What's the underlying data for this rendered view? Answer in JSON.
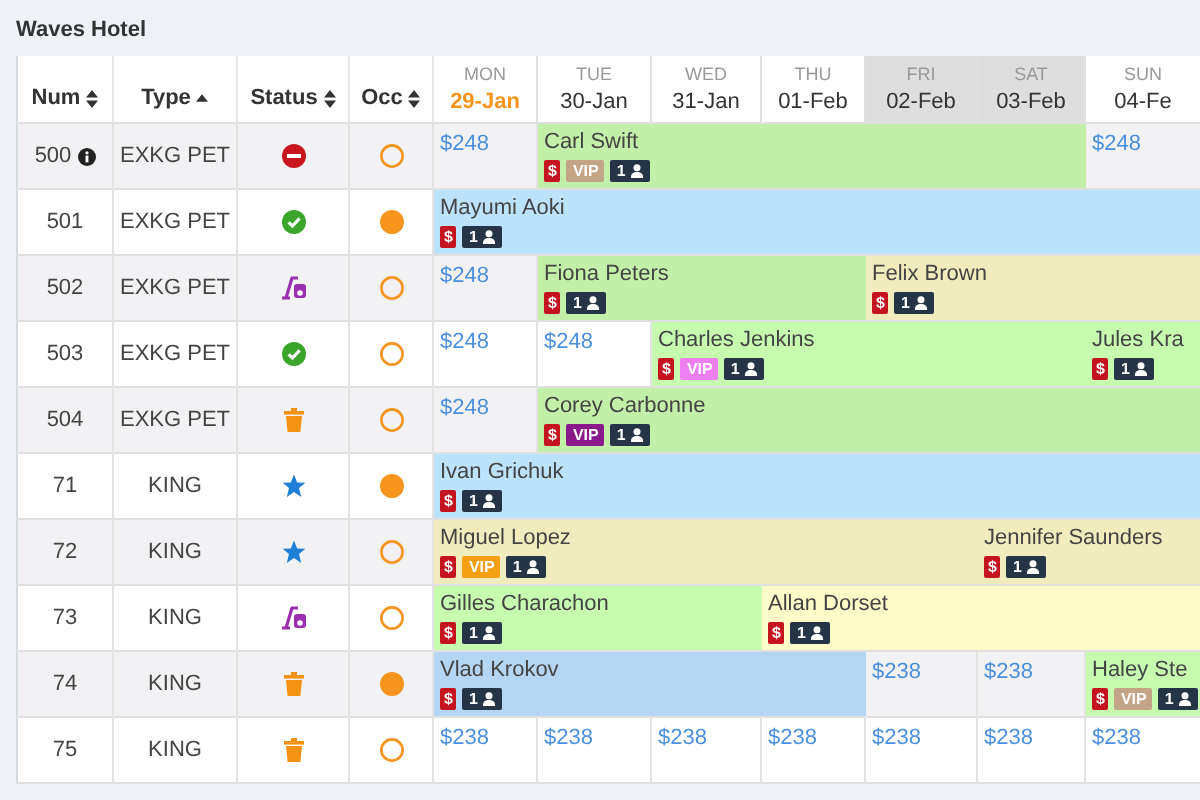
{
  "title": "Waves Hotel",
  "columns": [
    {
      "label": "Num",
      "sort": {
        "kind": "both"
      }
    },
    {
      "label": "Type",
      "sort": {
        "kind": "asc"
      }
    },
    {
      "label": "Status",
      "sort": {
        "kind": "both"
      }
    },
    {
      "label": "Occ",
      "sort": {
        "kind": "both"
      }
    }
  ],
  "days": [
    {
      "dow": "MON",
      "date": "29-Jan",
      "today": true,
      "weekend": false
    },
    {
      "dow": "TUE",
      "date": "30-Jan",
      "today": false,
      "weekend": false
    },
    {
      "dow": "WED",
      "date": "31-Jan",
      "today": false,
      "weekend": false
    },
    {
      "dow": "THU",
      "date": "01-Feb",
      "today": false,
      "weekend": false
    },
    {
      "dow": "FRI",
      "date": "02-Feb",
      "today": false,
      "weekend": true
    },
    {
      "dow": "SAT",
      "date": "03-Feb",
      "today": false,
      "weekend": true
    },
    {
      "dow": "SUN",
      "date": "04-Fe",
      "today": false,
      "weekend": false
    }
  ],
  "rooms": [
    {
      "num": "500",
      "info": true,
      "type": "EXKG PET",
      "status": {
        "kind": "blocked"
      },
      "occupied": false,
      "shaded": true,
      "cells": [
        {
          "kind": "price",
          "price": "$248"
        },
        {
          "kind": "booking",
          "guest": "Carl Swift",
          "color": "#c3f0a8",
          "paid": "$",
          "vip": {
            "text": "VIP",
            "color": "#c4a487"
          },
          "guests": "1"
        },
        {
          "kind": "stay"
        },
        {
          "kind": "stay"
        },
        {
          "kind": "stay"
        },
        {
          "kind": "stay"
        },
        {
          "kind": "price",
          "price": "$248"
        }
      ]
    },
    {
      "num": "501",
      "info": false,
      "type": "EXKG PET",
      "status": {
        "kind": "clean"
      },
      "occupied": true,
      "shaded": false,
      "cells": [
        {
          "kind": "booking",
          "guest": "Mayumi Aoki",
          "color": "#bde2fb",
          "paid": "$",
          "guests": "1"
        },
        {
          "kind": "stay"
        },
        {
          "kind": "stay"
        },
        {
          "kind": "stay"
        },
        {
          "kind": "stay"
        },
        {
          "kind": "stay"
        },
        {
          "kind": "stay"
        }
      ]
    },
    {
      "num": "502",
      "info": false,
      "type": "EXKG PET",
      "status": {
        "kind": "cleaning"
      },
      "occupied": false,
      "shaded": true,
      "cells": [
        {
          "kind": "price",
          "price": "$248"
        },
        {
          "kind": "booking",
          "guest": "Fiona Peters",
          "color": "#c3f0a8",
          "paid": "$",
          "guests": "1"
        },
        {
          "kind": "stay"
        },
        {
          "kind": "stay"
        },
        {
          "kind": "booking",
          "guest": "Felix Brown",
          "color": "#f1ecbe",
          "paid": "$",
          "guests": "1"
        },
        {
          "kind": "stay"
        },
        {
          "kind": "stay"
        }
      ]
    },
    {
      "num": "503",
      "info": false,
      "type": "EXKG PET",
      "status": {
        "kind": "clean"
      },
      "occupied": false,
      "shaded": false,
      "cells": [
        {
          "kind": "price",
          "price": "$248"
        },
        {
          "kind": "price",
          "price": "$248"
        },
        {
          "kind": "booking",
          "guest": "Charles Jenkins",
          "color": "#c6fbb0",
          "paid": "$",
          "vip": {
            "text": "VIP",
            "color": "#ee7ff0"
          },
          "guests": "1"
        },
        {
          "kind": "stay"
        },
        {
          "kind": "stay"
        },
        {
          "kind": "stay"
        },
        {
          "kind": "booking",
          "guest": "Jules Kra",
          "color": "#c6fbb0",
          "paid": "$",
          "guests": "1"
        }
      ]
    },
    {
      "num": "504",
      "info": false,
      "type": "EXKG PET",
      "status": {
        "kind": "dirty"
      },
      "occupied": false,
      "shaded": true,
      "cells": [
        {
          "kind": "price",
          "price": "$248"
        },
        {
          "kind": "booking",
          "guest": "Corey Carbonne",
          "color": "#c3f0a8",
          "paid": "$",
          "vip": {
            "text": "VIP",
            "color": "#8a1a8c"
          },
          "guests": "1"
        },
        {
          "kind": "stay"
        },
        {
          "kind": "stay"
        },
        {
          "kind": "stay"
        },
        {
          "kind": "stay"
        },
        {
          "kind": "stay"
        }
      ]
    },
    {
      "num": "71",
      "info": false,
      "type": "KING",
      "status": {
        "kind": "starred"
      },
      "occupied": true,
      "shaded": false,
      "cells": [
        {
          "kind": "booking",
          "guest": "Ivan Grichuk",
          "color": "#bde2fb",
          "paid": "$",
          "guests": "1"
        },
        {
          "kind": "stay"
        },
        {
          "kind": "stay"
        },
        {
          "kind": "stay"
        },
        {
          "kind": "stay"
        },
        {
          "kind": "stay"
        },
        {
          "kind": "stay"
        }
      ]
    },
    {
      "num": "72",
      "info": false,
      "type": "KING",
      "status": {
        "kind": "starred"
      },
      "occupied": false,
      "shaded": true,
      "cells": [
        {
          "kind": "booking",
          "guest": "Miguel Lopez",
          "color": "#f1ecbe",
          "paid": "$",
          "vip": {
            "text": "VIP",
            "color": "#f5a012"
          },
          "guests": "1"
        },
        {
          "kind": "stay"
        },
        {
          "kind": "stay"
        },
        {
          "kind": "stay"
        },
        {
          "kind": "stay"
        },
        {
          "kind": "booking",
          "guest": "Jennifer Saunders",
          "color": "#f1ecbe",
          "paid": "$",
          "guests": "1"
        },
        {
          "kind": "stay"
        }
      ]
    },
    {
      "num": "73",
      "info": false,
      "type": "KING",
      "status": {
        "kind": "cleaning"
      },
      "occupied": false,
      "shaded": false,
      "cells": [
        {
          "kind": "booking",
          "guest": "Gilles Charachon",
          "color": "#c6fbb0",
          "paid": "$",
          "guests": "1"
        },
        {
          "kind": "stay"
        },
        {
          "kind": "stay"
        },
        {
          "kind": "booking",
          "guest": "Allan Dorset",
          "color": "#fdfbc8",
          "paid": "$",
          "guests": "1"
        },
        {
          "kind": "stay"
        },
        {
          "kind": "stay"
        },
        {
          "kind": "stay"
        }
      ]
    },
    {
      "num": "74",
      "info": false,
      "type": "KING",
      "status": {
        "kind": "dirty"
      },
      "occupied": true,
      "shaded": true,
      "cells": [
        {
          "kind": "booking",
          "guest": "Vlad Krokov",
          "color": "#b5d6f2",
          "paid": "$",
          "guests": "1"
        },
        {
          "kind": "stay"
        },
        {
          "kind": "stay"
        },
        {
          "kind": "stay"
        },
        {
          "kind": "price",
          "price": "$238"
        },
        {
          "kind": "price",
          "price": "$238"
        },
        {
          "kind": "booking",
          "guest": "Haley Ste",
          "color": "#c6fbb0",
          "paid": "$",
          "vip": {
            "text": "VIP",
            "color": "#c4a487"
          },
          "guests": "1"
        }
      ]
    },
    {
      "num": "75",
      "info": false,
      "type": "KING",
      "status": {
        "kind": "dirty"
      },
      "occupied": false,
      "shaded": false,
      "cells": [
        {
          "kind": "price",
          "price": "$238"
        },
        {
          "kind": "price",
          "price": "$238"
        },
        {
          "kind": "price",
          "price": "$238"
        },
        {
          "kind": "price",
          "price": "$238"
        },
        {
          "kind": "price",
          "price": "$238"
        },
        {
          "kind": "price",
          "price": "$238"
        },
        {
          "kind": "price",
          "price": "$238"
        }
      ]
    }
  ]
}
